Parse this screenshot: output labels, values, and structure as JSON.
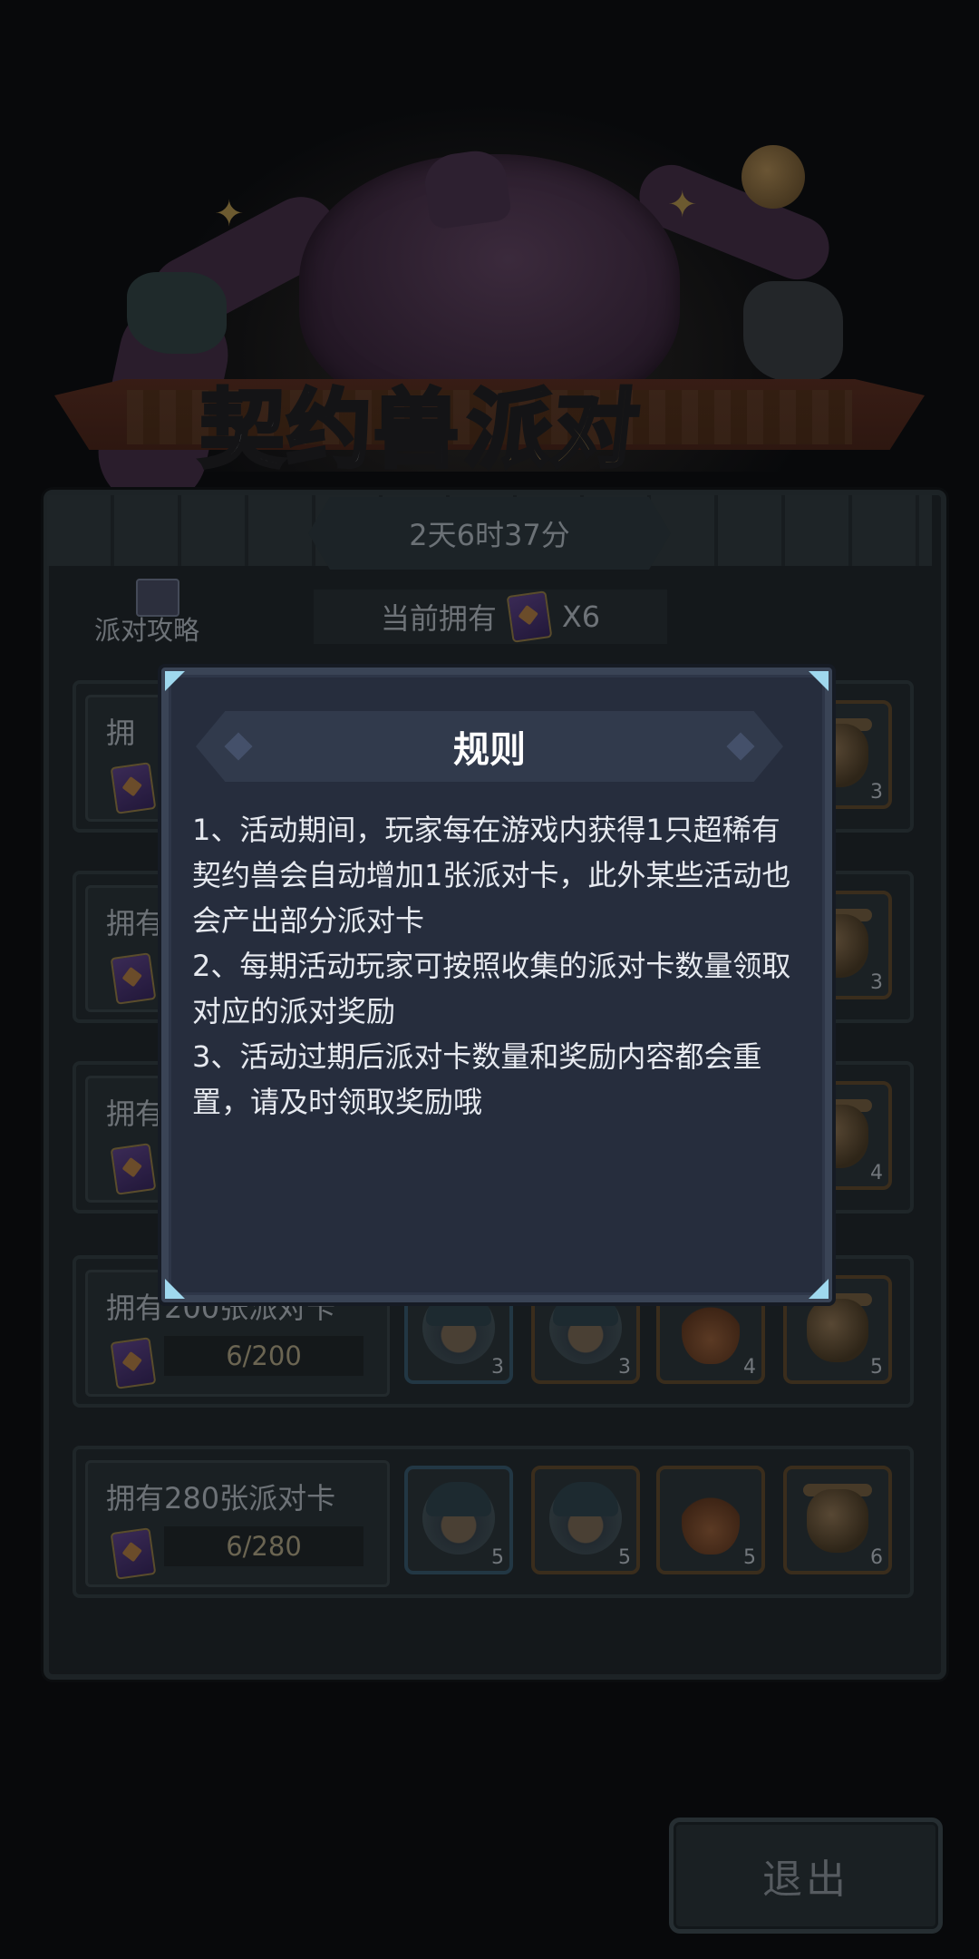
{
  "banner": {
    "title_part1": "契约兽",
    "title_part2": "派对"
  },
  "timer": "2天6时37分",
  "guide": {
    "label": "派对攻略"
  },
  "owned": {
    "label": "当前拥有",
    "count": "X6"
  },
  "rows": [
    {
      "title": "拥有200张派对卡",
      "progress": "6/200",
      "rewards": [
        "3",
        "3",
        "4",
        "5"
      ]
    },
    {
      "title": "拥有280张派对卡",
      "progress": "6/280",
      "rewards": [
        "5",
        "5",
        "5",
        "6"
      ]
    }
  ],
  "hidden_row_rewards": [
    [
      "3"
    ],
    [
      "3"
    ],
    [
      "4"
    ]
  ],
  "hidden_row_title": "拥",
  "hidden_row_title_b": "拥有",
  "exit_label": "退出",
  "dialog": {
    "title": "规则",
    "rules": [
      "1、活动期间，玩家每在游戏内获得1只超稀有契约兽会自动增加1张派对卡，此外某些活动也会产出部分派对卡",
      "2、每期活动玩家可按照收集的派对卡数量领取对应的派对奖励",
      "3、活动过期后派对卡数量和奖励内容都会重置，请及时领取奖励哦"
    ]
  },
  "colors": {
    "dialog_bg": "#262d3d",
    "corner_accent": "#9fd8ee",
    "text": "#e6e9ef"
  }
}
